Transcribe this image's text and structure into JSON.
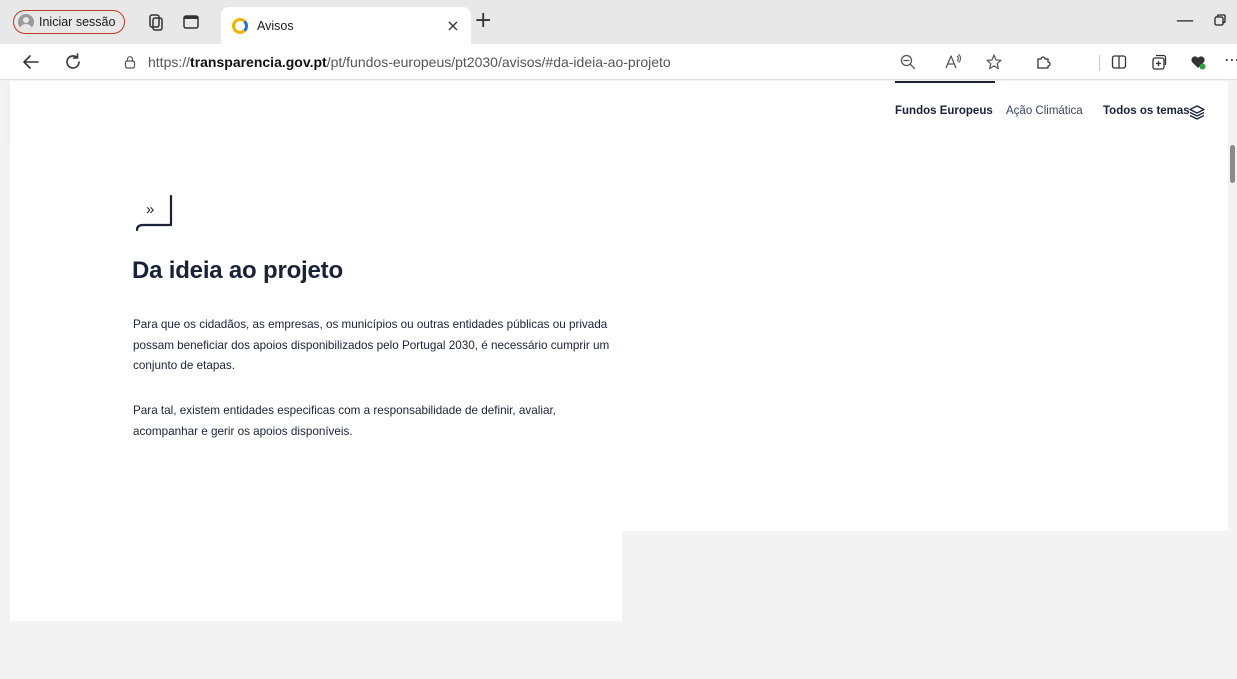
{
  "browser": {
    "profile_label": "Iniciar sessão",
    "tab": {
      "title": "Avisos",
      "close": "×"
    },
    "new_tab": "+",
    "minimize": "—",
    "url": {
      "prefix": "https://",
      "domain": "transparencia.gov.pt",
      "path": "/pt/fundos-europeus/pt2030/avisos/#da-ideia-ao-projeto"
    }
  },
  "header": {
    "nav": [
      "Fundos Europeus",
      "Ação Climática",
      "Todos os temas"
    ]
  },
  "section": {
    "icon_glyph": "»",
    "title": "Da ideia ao projeto",
    "paragraphs": [
      "Para que os cidadãos, as empresas, os municípios ou outras entidades públicas ou privada possam beneficiar dos apoios disponibilizados pelo Portugal 2030, é necessário cumprir um conjunto de etapas.",
      "Para tal, existem entidades especificas com a responsabilidade de definir, avaliar, acompanhar e gerir os apoios disponíveis."
    ]
  }
}
